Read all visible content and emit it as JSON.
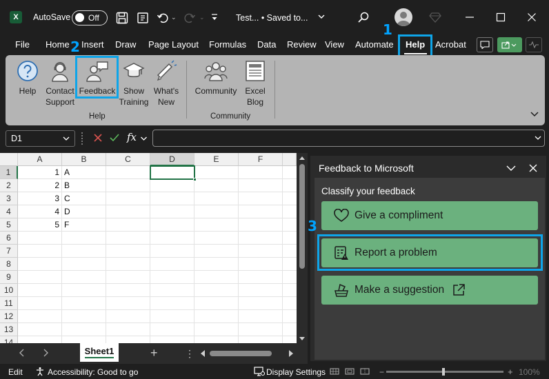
{
  "titlebar": {
    "app_icon": "excel-logo-icon",
    "autosave_label": "AutoSave",
    "autosave_state": "Off",
    "doc_title": "Test... • Saved to...",
    "doc_dropdown": "chevron-down-icon"
  },
  "menu": {
    "tabs": [
      "File",
      "Home",
      "Insert",
      "Draw",
      "Page Layout",
      "Formulas",
      "Data",
      "Review",
      "View",
      "Automate",
      "Help",
      "Acrobat"
    ],
    "active_tab": "Help"
  },
  "steps": {
    "one": "1",
    "two": "2",
    "three": "3"
  },
  "ribbon": {
    "help_group": {
      "label": "Help",
      "buttons": [
        {
          "label": "Help",
          "icon": "help-question-icon"
        },
        {
          "label": "Contact Support",
          "label_line1": "Contact",
          "label_line2": "Support",
          "icon": "contact-support-icon"
        },
        {
          "label": "Feedback",
          "icon": "feedback-icon"
        },
        {
          "label": "Show Training",
          "label_line1": "Show",
          "label_line2": "Training",
          "icon": "training-icon"
        },
        {
          "label": "What's New",
          "label_line1": "What's",
          "label_line2": "New",
          "icon": "megaphone-icon"
        }
      ]
    },
    "community_group": {
      "label": "Community",
      "buttons": [
        {
          "label": "Community",
          "icon": "community-icon"
        },
        {
          "label": "Excel Blog",
          "label_line1": "Excel",
          "label_line2": "Blog",
          "icon": "blog-icon"
        }
      ]
    }
  },
  "formula_bar": {
    "name_box": "D1",
    "cancel_icon": "cancel-x-icon",
    "enter_icon": "checkmark-icon",
    "fx": "fx",
    "formula": ""
  },
  "grid": {
    "columns": [
      "A",
      "B",
      "C",
      "D",
      "E",
      "F"
    ],
    "rows": [
      "1",
      "2",
      "3",
      "4",
      "5",
      "6",
      "7",
      "8",
      "9",
      "10",
      "11",
      "12",
      "13",
      "14"
    ],
    "selected_cell": "D1",
    "cells": [
      {
        "a": "1",
        "b": "A"
      },
      {
        "a": "2",
        "b": "B"
      },
      {
        "a": "3",
        "b": "C"
      },
      {
        "a": "4",
        "b": "D"
      },
      {
        "a": "5",
        "b": "F"
      }
    ]
  },
  "sheets": {
    "tabs": [
      "Sheet1"
    ],
    "add_label": "+",
    "more": "⋮"
  },
  "statusbar": {
    "mode": "Edit",
    "accessibility": "Accessibility: Good to go",
    "display_settings": "Display Settings",
    "zoom": "100%"
  },
  "feedback_pane": {
    "title": "Feedback to Microsoft",
    "subtitle": "Classify your feedback",
    "options": [
      {
        "label": "Give a compliment",
        "icon": "heart-icon"
      },
      {
        "label": "Report a problem",
        "icon": "report-problem-icon"
      },
      {
        "label": "Make a suggestion",
        "icon": "suggestion-icon",
        "external_icon": "external-link-icon"
      }
    ]
  },
  "colors": {
    "highlight": "#0ea5e9",
    "step_number": "#00a3ff",
    "feedback_button": "#6bb17e",
    "ribbon_bg": "#b4b4b4",
    "excel_green": "#185c37"
  }
}
